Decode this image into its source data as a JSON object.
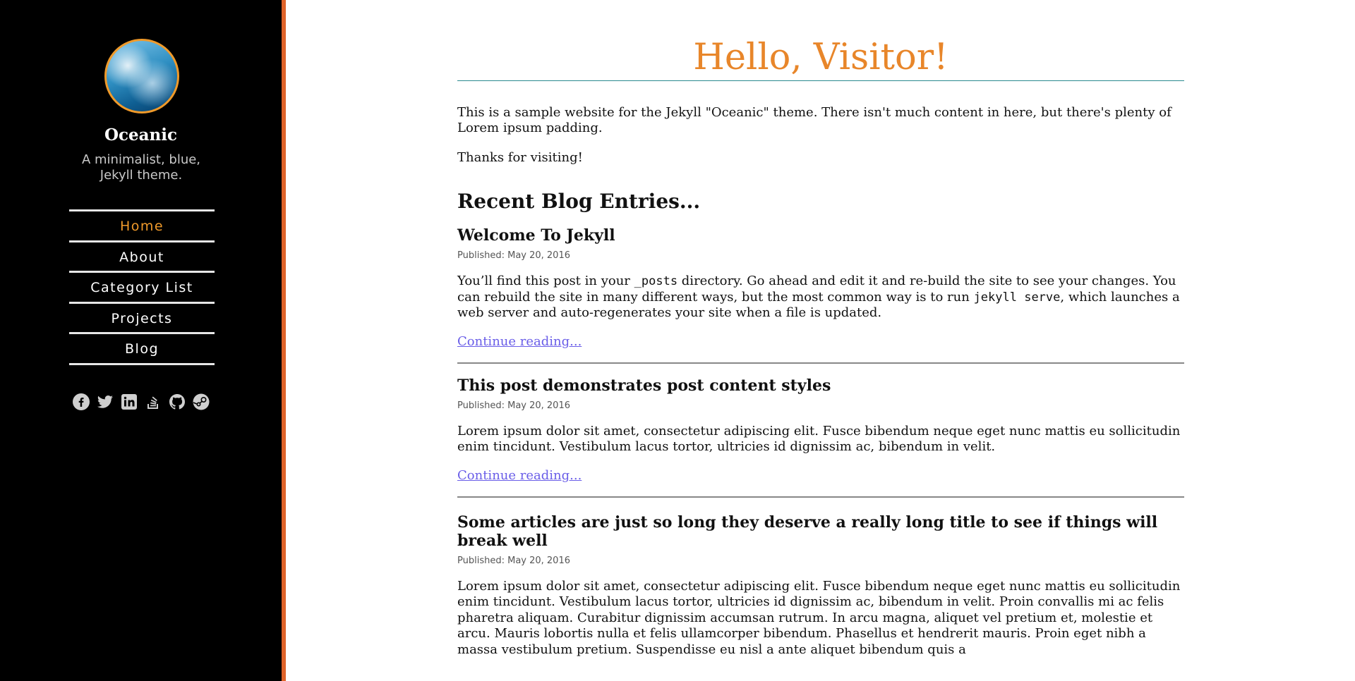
{
  "sidebar": {
    "site_title": "Oceanic",
    "site_description": "A minimalist, blue, Jekyll theme.",
    "nav": [
      {
        "label": "Home",
        "active": true
      },
      {
        "label": "About",
        "active": false
      },
      {
        "label": "Category List",
        "active": false
      },
      {
        "label": "Projects",
        "active": false
      },
      {
        "label": "Blog",
        "active": false
      }
    ],
    "social_icons": [
      "facebook-icon",
      "twitter-icon",
      "linkedin-icon",
      "stackoverflow-icon",
      "github-icon",
      "steam-icon"
    ]
  },
  "main": {
    "heading": "Hello, Visitor!",
    "intro": "This is a sample website for the Jekyll \"Oceanic\" theme. There isn't much content in here, but there's plenty of Lorem ipsum padding.",
    "thanks": "Thanks for visiting!",
    "recent_heading": "Recent Blog Entries...",
    "posts": [
      {
        "title": "Welcome To Jekyll",
        "date": "Published: May 20, 2016",
        "excerpt_parts": [
          "You’ll find this post in your ",
          "_posts",
          " directory. Go ahead and edit it and re-build the site to see your changes. You can rebuild the site in many different ways, but the most common way is to run ",
          "jekyll serve",
          ", which launches a web server and auto-regenerates your site when a file is updated."
        ],
        "more_label": "Continue reading..."
      },
      {
        "title": "This post demonstrates post content styles",
        "date": "Published: May 20, 2016",
        "excerpt": "Lorem ipsum dolor sit amet, consectetur adipiscing elit. Fusce bibendum neque eget nunc mattis eu sollicitudin enim tincidunt. Vestibulum lacus tortor, ultricies id dignissim ac, bibendum in velit.",
        "more_label": "Continue reading..."
      },
      {
        "title": "Some articles are just so long they deserve a really long title to see if things will break well",
        "date": "Published: May 20, 2016",
        "excerpt": "Lorem ipsum dolor sit amet, consectetur adipiscing elit. Fusce bibendum neque eget nunc mattis eu sollicitudin enim tincidunt. Vestibulum lacus tortor, ultricies id dignissim ac, bibendum in velit. Proin convallis mi ac felis pharetra aliquam. Curabitur dignissim accumsan rutrum. In arcu magna, aliquet vel pretium et, molestie et arcu. Mauris lobortis nulla et felis ullamcorper bibendum. Phasellus et hendrerit mauris. Proin eget nibh a massa vestibulum pretium. Suspendisse eu nisl a ante aliquet bibendum quis a"
      }
    ]
  },
  "colors": {
    "accent": "#e8862a",
    "sidebar_border": "#e0642a",
    "link": "#6a5ee8",
    "divider": "#2a8a8f"
  }
}
